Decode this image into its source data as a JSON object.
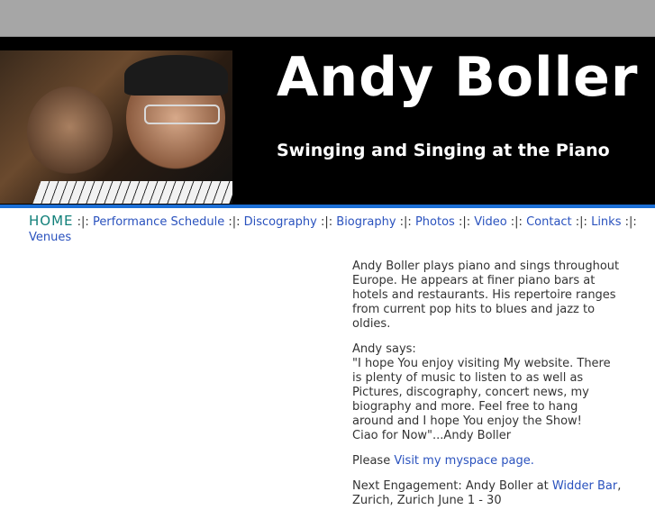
{
  "header": {
    "title": "Andy Boller",
    "tagline": "Swinging and Singing at the Piano"
  },
  "nav": {
    "home": "HOME",
    "separator": ":|:",
    "links": [
      "Performance Schedule",
      "Discography",
      "Biography",
      "Photos",
      "Video",
      "Contact",
      "Links",
      "Venues"
    ]
  },
  "content": {
    "intro": "Andy Boller plays piano and sings throughout Europe. He appears at finer piano bars at hotels and restaurants. His repertoire ranges from current pop hits to blues and jazz to oldies.",
    "says_label": "Andy says:",
    "quote": "\"I hope You enjoy visiting My website. There is plenty of music to listen to as well as Pictures, discography, concert news, my biography and more. Feel free to hang around and I hope You enjoy the Show!",
    "signoff": "Ciao for Now\"...Andy Boller",
    "please": "Please",
    "myspace_link": "Visit my myspace page.",
    "next_prefix": "Next Engagement: Andy Boller at",
    "venue_link": "Widder Bar",
    "next_suffix": ", Zurich, Zurich June 1 - 30"
  }
}
